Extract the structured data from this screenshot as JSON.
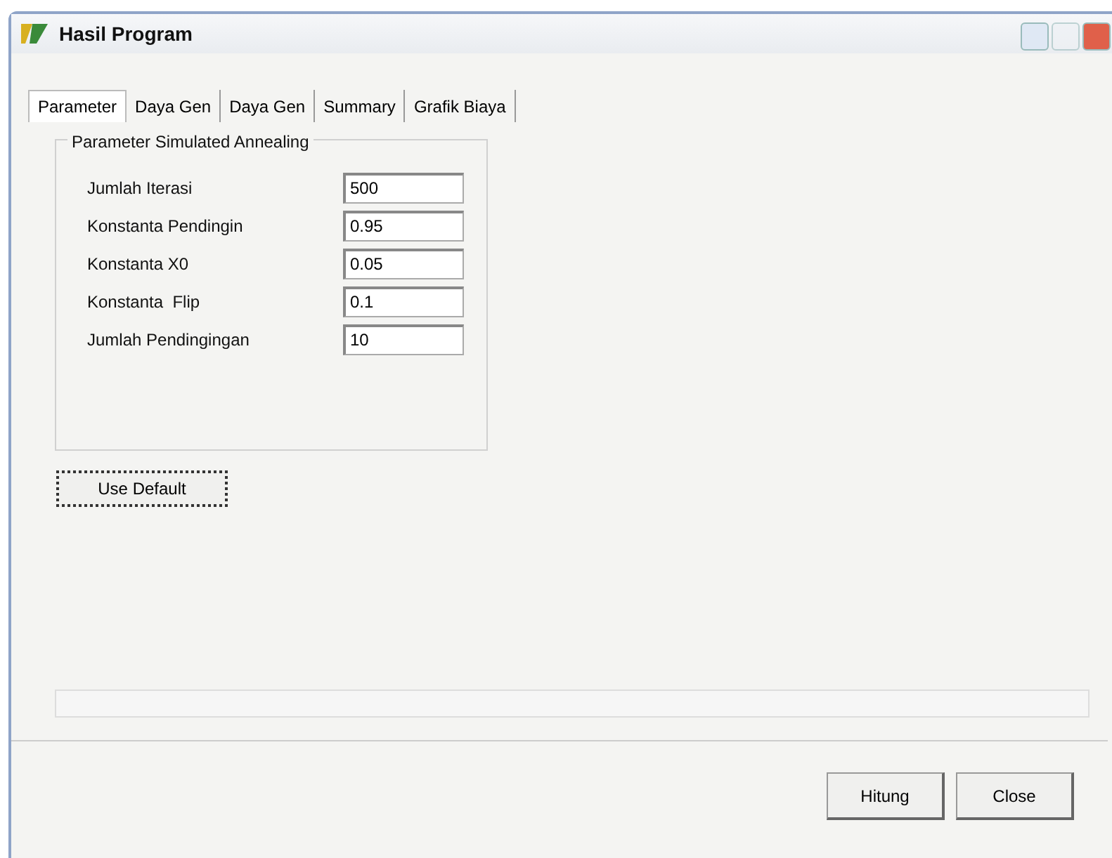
{
  "window": {
    "title": "Hasil Program"
  },
  "tabs": [
    {
      "label": "Parameter",
      "selected": true
    },
    {
      "label": "Daya Gen",
      "selected": false
    },
    {
      "label": "Daya Gen",
      "selected": false
    },
    {
      "label": "Summary",
      "selected": false
    },
    {
      "label": "Grafik Biaya",
      "selected": false
    }
  ],
  "group": {
    "title": "Parameter Simulated Annealing",
    "fields": [
      {
        "label": "Jumlah Iterasi",
        "value": "500"
      },
      {
        "label": "Konstanta Pendingin",
        "value": "0.95"
      },
      {
        "label": "Konstanta X0",
        "value": "0.05"
      },
      {
        "label": "Konstanta  Flip",
        "value": "0.1"
      },
      {
        "label": "Jumlah Pendingingan",
        "value": "10"
      }
    ]
  },
  "default_button": "Use Default",
  "progress": {
    "level": 0
  },
  "buttons": [
    "Hitung",
    "Close"
  ]
}
